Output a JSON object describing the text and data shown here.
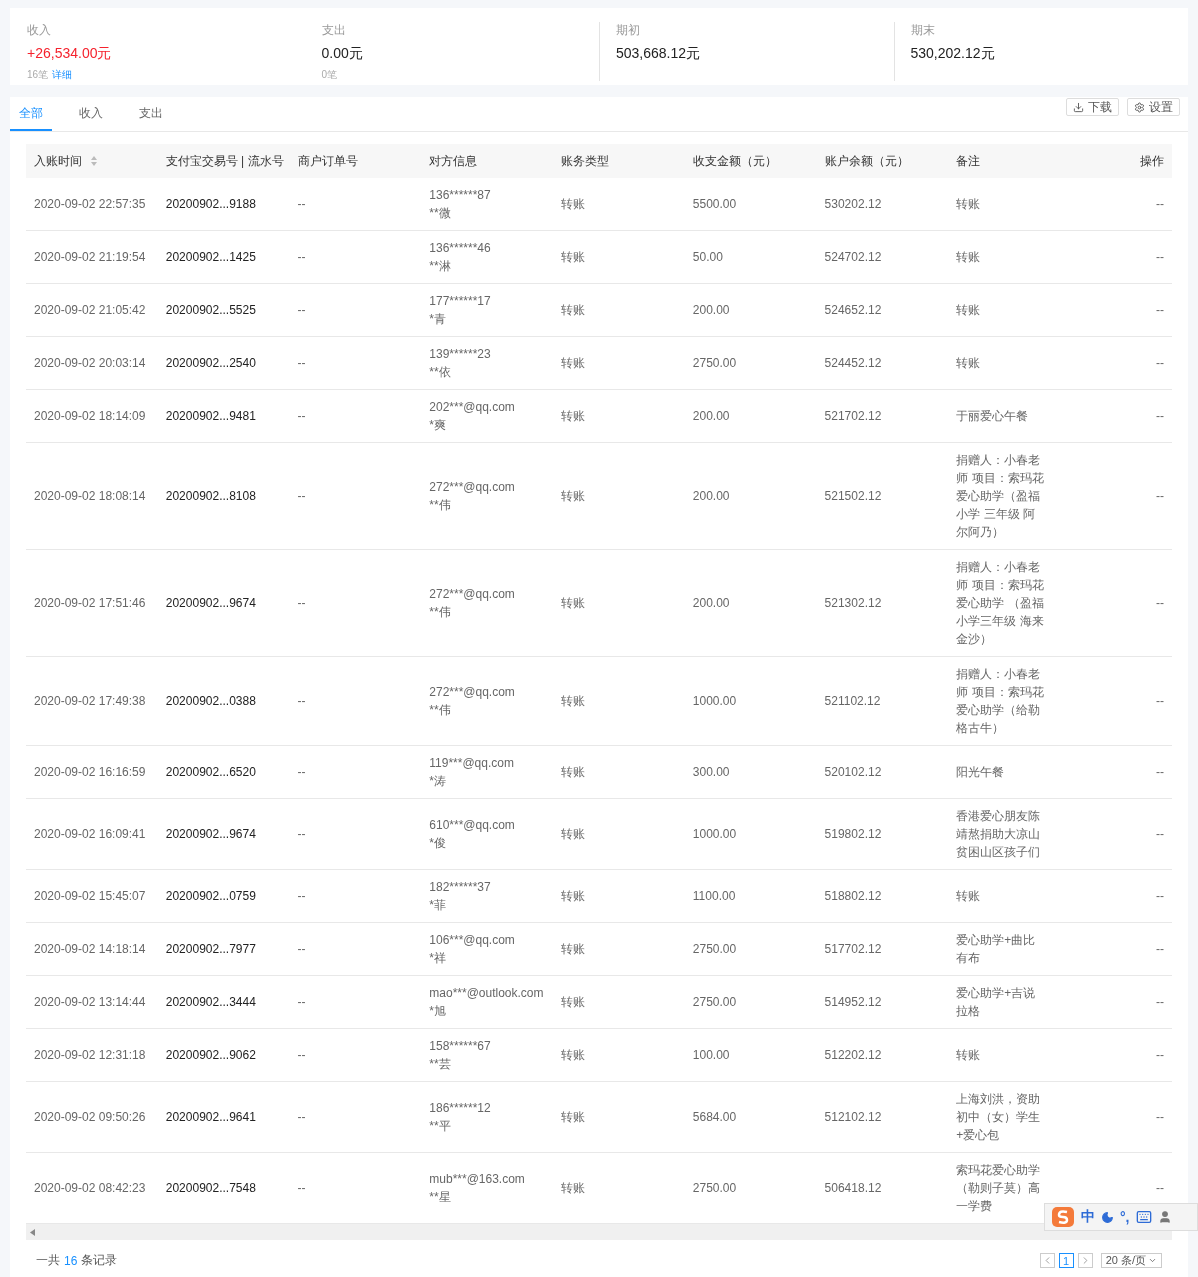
{
  "summary": [
    {
      "label": "收入",
      "value": "+26,534.00元",
      "highlight": true,
      "divider": false,
      "count": "16笔",
      "link": "详细"
    },
    {
      "label": "支出",
      "value": "0.00元",
      "highlight": false,
      "divider": false,
      "count": "0笔"
    },
    {
      "label": "期初",
      "value": "503,668.12元",
      "highlight": false,
      "divider": true
    },
    {
      "label": "期末",
      "value": "530,202.12元",
      "highlight": false,
      "divider": true
    }
  ],
  "tabs": [
    {
      "label": "全部",
      "selected": true
    },
    {
      "label": "收入",
      "selected": false
    },
    {
      "label": "支出",
      "selected": false
    }
  ],
  "actions": [
    {
      "kind": "download",
      "label": "下载"
    },
    {
      "kind": "settings",
      "label": "设置"
    }
  ],
  "table": {
    "columns": [
      {
        "label": "入账时间",
        "sortable": true
      },
      {
        "label": "支付宝交易号 | 流水号",
        "sortable": false
      },
      {
        "label": "商户订单号",
        "sortable": false
      },
      {
        "label": "对方信息",
        "sortable": false
      },
      {
        "label": "账务类型",
        "sortable": false
      },
      {
        "label": "收支金额（元）",
        "sortable": false
      },
      {
        "label": "账户余额（元）",
        "sortable": false
      },
      {
        "label": "备注",
        "sortable": false
      },
      {
        "label": "操作",
        "sortable": false
      }
    ],
    "rows": [
      [
        "2020-09-02 22:57:35",
        "20200902...9188",
        "--",
        [
          "136******87",
          "**微"
        ],
        "转账",
        "5500.00",
        "530202.12",
        "转账",
        "--"
      ],
      [
        "2020-09-02 21:19:54",
        "20200902...1425",
        "--",
        [
          "136******46",
          "**淋"
        ],
        "转账",
        "50.00",
        "524702.12",
        "转账",
        "--"
      ],
      [
        "2020-09-02 21:05:42",
        "20200902...5525",
        "--",
        [
          "177******17",
          "*青"
        ],
        "转账",
        "200.00",
        "524652.12",
        "转账",
        "--"
      ],
      [
        "2020-09-02 20:03:14",
        "20200902...2540",
        "--",
        [
          "139******23",
          "**依"
        ],
        "转账",
        "2750.00",
        "524452.12",
        "转账",
        "--"
      ],
      [
        "2020-09-02 18:14:09",
        "20200902...9481",
        "--",
        [
          "202***@qq.com",
          "*爽"
        ],
        "转账",
        "200.00",
        "521702.12",
        "于丽爱心午餐",
        "--"
      ],
      [
        "2020-09-02 18:08:14",
        "20200902...8108",
        "--",
        [
          "272***@qq.com",
          "**伟"
        ],
        "转账",
        "200.00",
        "521502.12",
        "捐赠人：小春老师 项目：索玛花爱心助学（盈福小学 三年级 阿尔阿乃）",
        "--"
      ],
      [
        "2020-09-02 17:51:46",
        "20200902...9674",
        "--",
        [
          "272***@qq.com",
          "**伟"
        ],
        "转账",
        "200.00",
        "521302.12",
        "捐赠人：小春老师 项目：索玛花爱心助学 （盈福小学三年级 海来金沙）",
        "--"
      ],
      [
        "2020-09-02 17:49:38",
        "20200902...0388",
        "--",
        [
          "272***@qq.com",
          "**伟"
        ],
        "转账",
        "1000.00",
        "521102.12",
        "捐赠人：小春老师 项目：索玛花爱心助学（给勒格古牛）",
        "--"
      ],
      [
        "2020-09-02 16:16:59",
        "20200902...6520",
        "--",
        [
          "119***@qq.com",
          "*涛"
        ],
        "转账",
        "300.00",
        "520102.12",
        "阳光午餐",
        "--"
      ],
      [
        "2020-09-02 16:09:41",
        "20200902...9674",
        "--",
        [
          "610***@qq.com",
          "*俊"
        ],
        "转账",
        "1000.00",
        "519802.12",
        "香港爱心朋友陈靖熬捐助大凉山贫困山区孩子们",
        "--"
      ],
      [
        "2020-09-02 15:45:07",
        "20200902...0759",
        "--",
        [
          "182******37",
          "*菲"
        ],
        "转账",
        "1100.00",
        "518802.12",
        "转账",
        "--"
      ],
      [
        "2020-09-02 14:18:14",
        "20200902...7977",
        "--",
        [
          "106***@qq.com",
          "*祥"
        ],
        "转账",
        "2750.00",
        "517702.12",
        "爱心助学+曲比有布",
        "--"
      ],
      [
        "2020-09-02 13:14:44",
        "20200902...3444",
        "--",
        [
          "mao***@outlook.com",
          "*旭"
        ],
        "转账",
        "2750.00",
        "514952.12",
        "爱心助学+吉说拉格",
        "--"
      ],
      [
        "2020-09-02 12:31:18",
        "20200902...9062",
        "--",
        [
          "158******67",
          "**芸"
        ],
        "转账",
        "100.00",
        "512202.12",
        "转账",
        "--"
      ],
      [
        "2020-09-02 09:50:26",
        "20200902...9641",
        "--",
        [
          "186******12",
          "**平"
        ],
        "转账",
        "5684.00",
        "512102.12",
        "上海刘洪，资助初中（女）学生+爱心包",
        "--"
      ],
      [
        "2020-09-02 08:42:23",
        "20200902...7548",
        "--",
        [
          "mub***@163.com",
          "**星"
        ],
        "转账",
        "2750.00",
        "506418.12",
        "索玛花爱心助学（勒则子莫）高一学费",
        "--"
      ]
    ]
  },
  "footer": {
    "prefix": "一共",
    "count": "16",
    "suffix": "条记录"
  },
  "pagination": {
    "pages": [
      {
        "label": "1",
        "selected": true
      }
    ],
    "page_size": "20 条/页"
  },
  "ime_toolbar": {
    "mode": "中",
    "punct": "°,"
  }
}
